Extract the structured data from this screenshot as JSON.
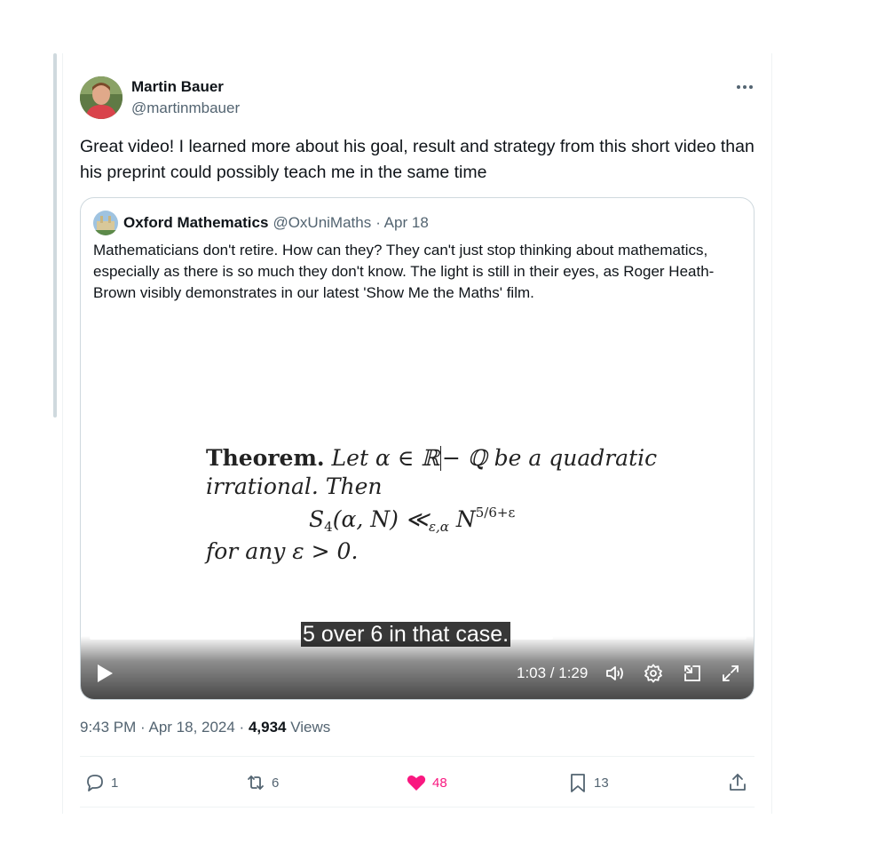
{
  "author": {
    "name": "Martin Bauer",
    "handle": "@martinmbauer"
  },
  "tweet": {
    "text": "Great video! I learned more about his goal, result and strategy from this short video than his preprint could possibly teach me in the same time"
  },
  "quoted": {
    "name": "Oxford Mathematics",
    "handle": "@OxUniMaths",
    "date": "· Apr 18",
    "text": "Mathematicians don't retire. How can they? They can't just stop thinking about mathematics, especially as there is so much they don't know. The light is still in their eyes, as Roger Heath-Brown visibly demonstrates in our latest 'Show Me the Maths' film."
  },
  "video": {
    "theorem_label": "Theorem.",
    "theorem_line1": "Let α ∈ ℝ",
    "theorem_line1b": "− ℚ be a quadratic",
    "theorem_line2": "irrational.  Then",
    "formula_main": "S",
    "formula_sub4": "4",
    "formula_args": "(α, N) ≪",
    "formula_sub": "ε,α",
    "formula_N": " N",
    "formula_sup": "5/6+ε",
    "theorem_line4": "for any ε > 0.",
    "caption": "5 over 6 in that case.",
    "time": "1:03 / 1:29",
    "progress": 0.706
  },
  "meta": {
    "time": "9:43 PM · Apr 18, 2024 · ",
    "views_count": "4,934",
    "views_label": " Views"
  },
  "actions": {
    "replies": "1",
    "reposts": "6",
    "likes": "48",
    "bookmarks": "13"
  },
  "colors": {
    "like": "#f91880",
    "secondary_text": "#536471",
    "primary_text": "#0f1419",
    "border": "#cfd9de"
  }
}
